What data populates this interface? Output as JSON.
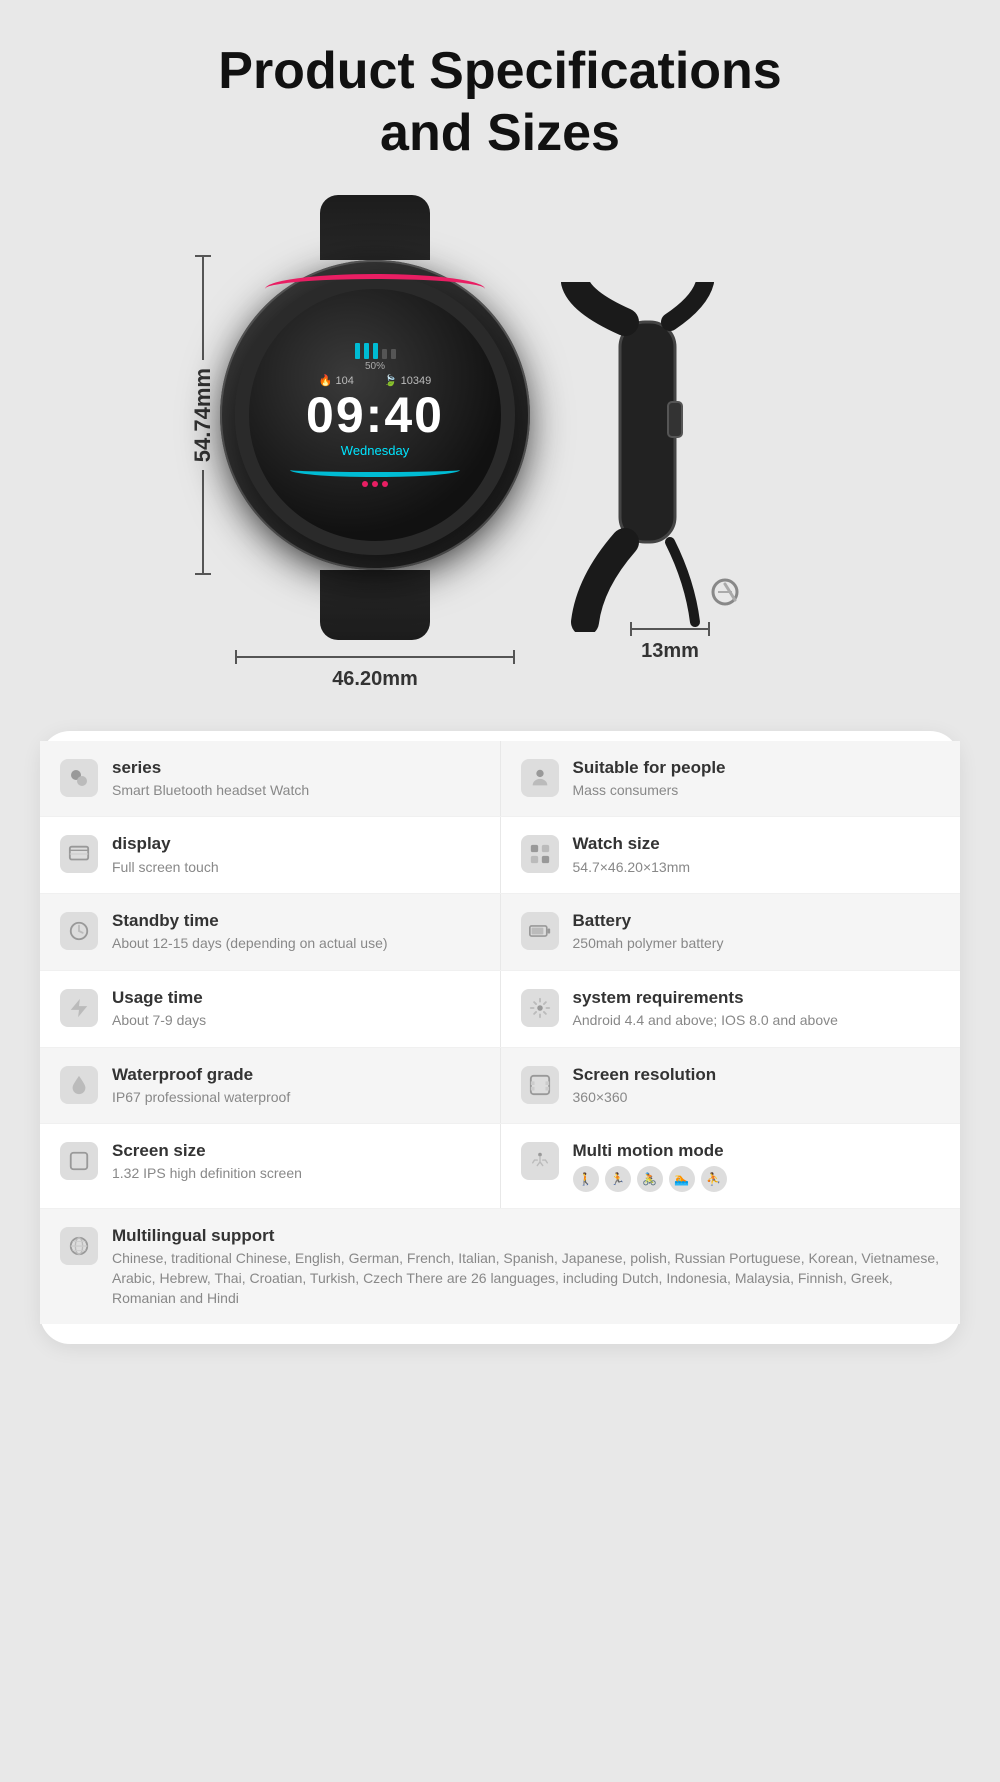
{
  "page": {
    "title_line1": "Product Specifications",
    "title_line2": "and Sizes"
  },
  "diagram": {
    "front_dim_v": "54.74mm",
    "front_dim_h": "46.20mm",
    "side_dim_h": "13mm",
    "watch_time": "09:40",
    "watch_day": "Wednesday",
    "watch_stats_left": "104",
    "watch_stats_right": "10349"
  },
  "specs": [
    {
      "shaded": true,
      "left": {
        "icon": "⬡",
        "title": "series",
        "value": "Smart Bluetooth headset Watch"
      },
      "right": {
        "icon": "👤",
        "title": "Suitable for people",
        "value": "Mass consumers"
      }
    },
    {
      "shaded": false,
      "left": {
        "icon": "☰",
        "title": "display",
        "value": "Full screen touch"
      },
      "right": {
        "icon": "⊞",
        "title": "Watch size",
        "value": "54.7×46.20×13mm"
      }
    },
    {
      "shaded": true,
      "left": {
        "icon": "◷",
        "title": "Standby time",
        "value": "About 12-15 days (depending on actual use)"
      },
      "right": {
        "icon": "▭",
        "title": "Battery",
        "value": "250mah polymer battery"
      }
    },
    {
      "shaded": false,
      "left": {
        "icon": "⚡",
        "title": "Usage time",
        "value": "About 7-9 days"
      },
      "right": {
        "icon": "⚙",
        "title": "system requirements",
        "value": "Android 4.4 and above; IOS 8.0 and above"
      }
    },
    {
      "shaded": true,
      "left": {
        "icon": "💧",
        "title": "Waterproof grade",
        "value": "IP67 professional waterproof"
      },
      "right": {
        "icon": "⊡",
        "title": "Screen resolution",
        "value": "360×360"
      }
    },
    {
      "shaded": false,
      "left": {
        "icon": "⊞",
        "title": "Screen size",
        "value": "1.32 IPS high definition screen"
      },
      "right": {
        "icon": "🏃",
        "title": "Multi motion mode",
        "value": "",
        "has_motion_icons": true
      }
    }
  ],
  "multilingual": {
    "shaded": true,
    "icon": "🌐",
    "title": "Multilingual support",
    "value": "Chinese, traditional Chinese, English, German, French, Italian, Spanish, Japanese, polish, Russian Portuguese, Korean, Vietnamese, Arabic, Hebrew, Thai, Croatian, Turkish, Czech There are 26 languages, including Dutch, Indonesia, Malaysia, Finnish, Greek, Romanian and Hindi"
  }
}
